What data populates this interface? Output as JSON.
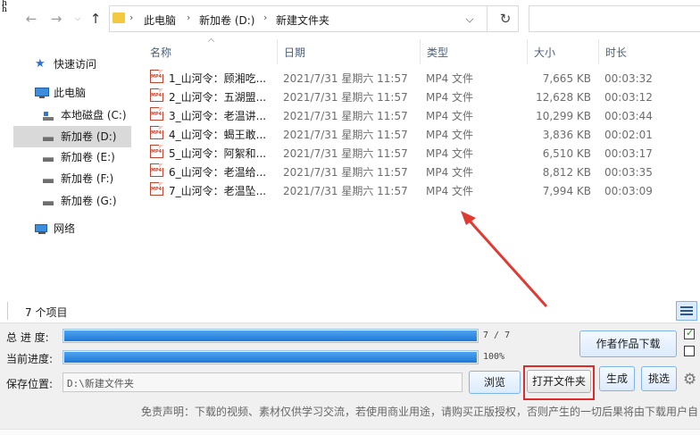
{
  "top_glyphs": [
    "h",
    "h"
  ],
  "address": {
    "path": [
      "此电脑",
      "新加卷 (D:)",
      "新建文件夹"
    ]
  },
  "nav": {
    "items": [
      {
        "label": "快速访问",
        "icon": "star-icon"
      },
      {
        "label": "此电脑",
        "icon": "computer-icon"
      },
      {
        "label": "本地磁盘 (C:)",
        "icon": "system-drive-icon"
      },
      {
        "label": "新加卷 (D:)",
        "icon": "drive-icon"
      },
      {
        "label": "新加卷 (E:)",
        "icon": "drive-icon"
      },
      {
        "label": "新加卷 (F:)",
        "icon": "drive-icon"
      },
      {
        "label": "新加卷 (G:)",
        "icon": "drive-icon"
      },
      {
        "label": "网络",
        "icon": "network-icon"
      }
    ]
  },
  "columns": {
    "name": "名称",
    "date": "日期",
    "type": "类型",
    "size": "大小",
    "duration": "时长"
  },
  "files": [
    {
      "name": "1_山河令：顾湘吃...",
      "date": "2021/7/31 星期六 11:57",
      "type": "MP4 文件",
      "size": "7,665 KB",
      "duration": "00:03:32"
    },
    {
      "name": "2_山河令：五湖盟...",
      "date": "2021/7/31 星期六 11:57",
      "type": "MP4 文件",
      "size": "12,628 KB",
      "duration": "00:03:12"
    },
    {
      "name": "3_山河令：老温讲...",
      "date": "2021/7/31 星期六 11:57",
      "type": "MP4 文件",
      "size": "10,299 KB",
      "duration": "00:03:44"
    },
    {
      "name": "4_山河令：蝎王敢...",
      "date": "2021/7/31 星期六 11:57",
      "type": "MP4 文件",
      "size": "3,836 KB",
      "duration": "00:02:01"
    },
    {
      "name": "5_山河令：阿絮和...",
      "date": "2021/7/31 星期六 11:57",
      "type": "MP4 文件",
      "size": "6,510 KB",
      "duration": "00:03:17"
    },
    {
      "name": "6_山河令：老温给...",
      "date": "2021/7/31 星期六 11:57",
      "type": "MP4 文件",
      "size": "8,812 KB",
      "duration": "00:03:35"
    },
    {
      "name": "7_山河令：老温坠...",
      "date": "2021/7/31 星期六 11:57",
      "type": "MP4 文件",
      "size": "7,994 KB",
      "duration": "00:03:09"
    }
  ],
  "status": {
    "item_count": "7 个项目"
  },
  "downloader": {
    "total_label": "总 进 度:",
    "total_text": "7 / 7",
    "total_fraction": 1.0,
    "current_label": "当前进度:",
    "current_text": "100%",
    "current_fraction": 1.0,
    "save_label": "保存位置:",
    "save_path": "D:\\新建文件夹",
    "browse": "浏览",
    "open_folder": "打开文件夹",
    "generate": "生成",
    "pick": "挑选",
    "author_works": "作者作品下载",
    "disclaimer": "免责声明：下载的视频、素材仅供学习交流，若使用商业用途，请购买正版授权，否则产生的一切后果将由下载用户自"
  },
  "colors": {
    "highlight_box": "#e02a2a",
    "arrow": "#e03a32",
    "progress": "#1e78d6",
    "selection": "#d9d9d9"
  }
}
